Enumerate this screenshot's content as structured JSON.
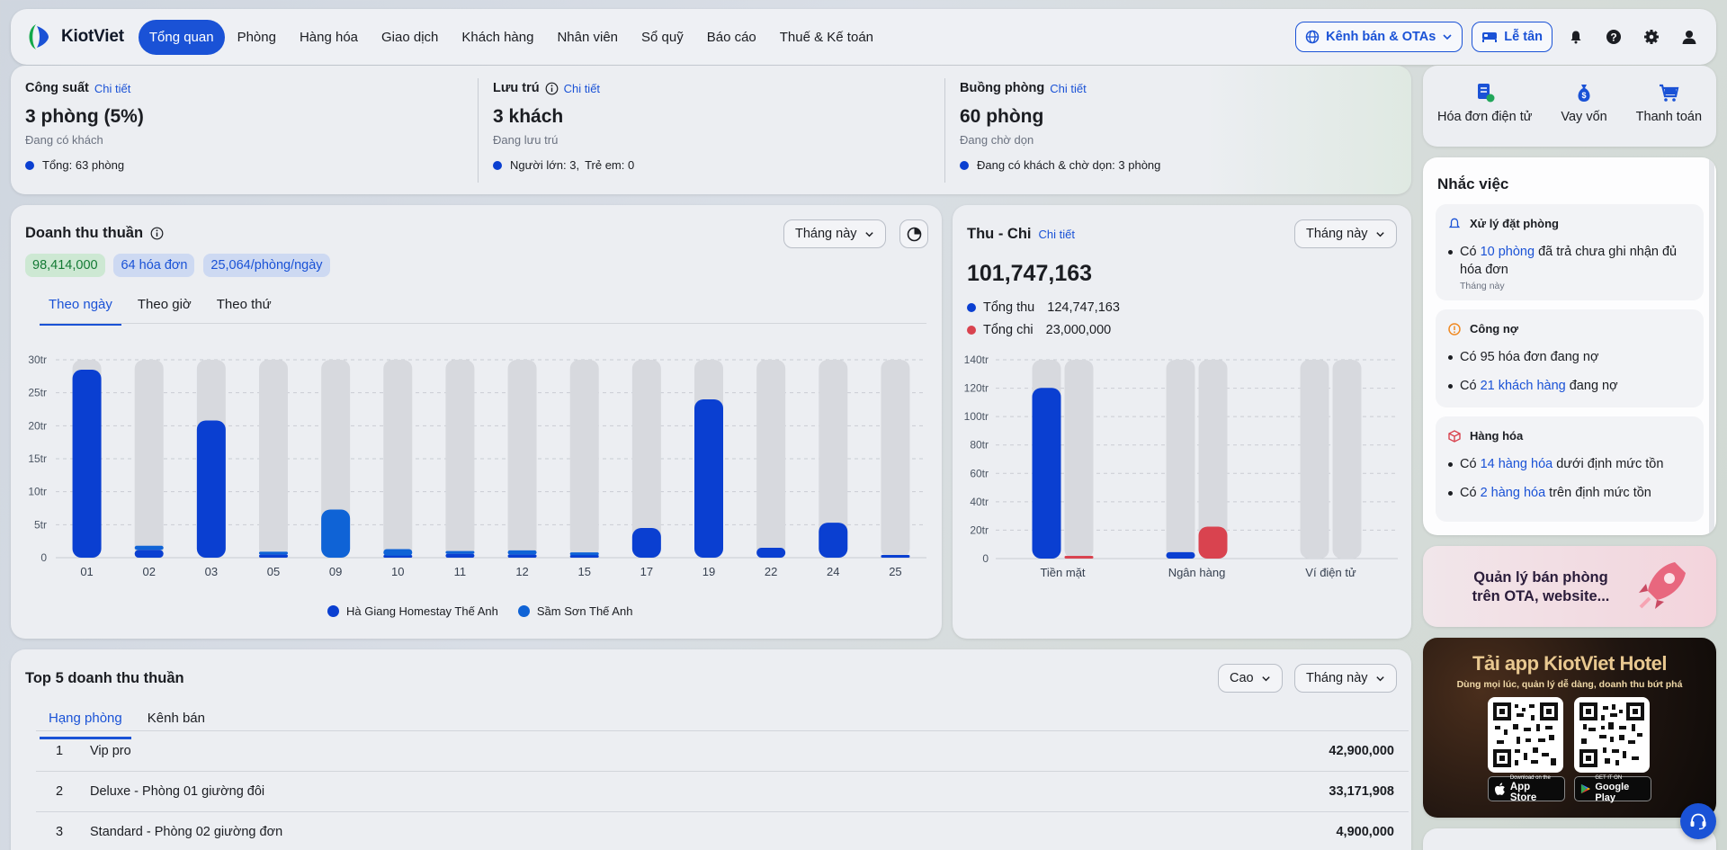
{
  "header": {
    "logo_text": "KiotViet",
    "nav": [
      "Tổng quan",
      "Phòng",
      "Hàng hóa",
      "Giao dịch",
      "Khách hàng",
      "Nhân viên",
      "Sổ quỹ",
      "Báo cáo",
      "Thuế & Kế toán"
    ],
    "channel_button": "Kênh bán & OTAs",
    "reception_button": "Lễ tân",
    "icons": [
      "bell-icon",
      "help-icon",
      "gear-icon",
      "user-icon"
    ]
  },
  "stats": {
    "capacity": {
      "title": "Công suất",
      "link": "Chi tiết",
      "value": "3 phòng (5%)",
      "sub": "Đang có khách",
      "foot": "Tổng: 63 phòng"
    },
    "stay": {
      "title": "Lưu trú",
      "link": "Chi tiết",
      "value": "3 khách",
      "sub": "Đang lưu trú",
      "foot_adults": "Người lớn: 3,",
      "foot_children": "Trẻ em: 0"
    },
    "housekeeping": {
      "title": "Buồng phòng",
      "link": "Chi tiết",
      "value": "60 phòng",
      "sub": "Đang chờ dọn",
      "foot": "Đang có khách & chờ dọn: 3 phòng"
    }
  },
  "revenue": {
    "title": "Doanh thu thuần",
    "period": "Tháng này",
    "chips": [
      "98,414,000",
      "64 hóa đơn",
      "25,064/phòng/ngày"
    ],
    "tabs": [
      "Theo ngày",
      "Theo giờ",
      "Theo thứ"
    ],
    "legend": [
      "Hà Giang Homestay Thế Anh",
      "Sầm Sơn Thế Anh"
    ]
  },
  "cashflow": {
    "title": "Thu - Chi",
    "link": "Chi tiết",
    "period": "Tháng này",
    "total": "101,747,163",
    "income_label": "Tổng thu",
    "income_value": "124,747,163",
    "expense_label": "Tổng chi",
    "expense_value": "23,000,000"
  },
  "chart_data": [
    {
      "type": "bar",
      "title": "Doanh thu thuần",
      "categories": [
        "01",
        "02",
        "03",
        "05",
        "09",
        "10",
        "11",
        "12",
        "15",
        "17",
        "19",
        "22",
        "24",
        "25"
      ],
      "y_ticks": [
        "0",
        "5tr",
        "10tr",
        "15tr",
        "20tr",
        "25tr",
        "30tr"
      ],
      "ylim": [
        0,
        30
      ],
      "series": [
        {
          "name": "Hà Giang Homestay Thế Anh",
          "color": "#0a3fd1",
          "values": [
            28.5,
            1.2,
            20.8,
            0.5,
            0,
            0.3,
            0.6,
            0.5,
            0.4,
            4.5,
            24,
            1.5,
            5.3,
            0.2
          ]
        },
        {
          "name": "Sầm Sơn Thế Anh",
          "color": "#0f63d6",
          "values": [
            0,
            0.6,
            0,
            0.3,
            7.3,
            1.0,
            0.2,
            0.6,
            0.2,
            0,
            0,
            0,
            0,
            0
          ]
        }
      ],
      "grid": true,
      "legend": "bottom"
    },
    {
      "type": "bar",
      "title": "Thu - Chi",
      "categories": [
        "Tiền mặt",
        "Ngân hàng",
        "Ví điện tử"
      ],
      "y_ticks": [
        "0",
        "20tr",
        "40tr",
        "60tr",
        "80tr",
        "100tr",
        "120tr",
        "140tr"
      ],
      "ylim": [
        0,
        140
      ],
      "series": [
        {
          "name": "Tổng thu",
          "color": "#0a3fd1",
          "values": [
            120.2,
            4.5,
            0
          ]
        },
        {
          "name": "Tổng chi",
          "color": "#d9434f",
          "values": [
            0.5,
            22.5,
            0
          ]
        }
      ],
      "grid": true,
      "legend": "top-left"
    }
  ],
  "right_panel": {
    "quick": [
      "Hóa đơn điện tử",
      "Vay vốn",
      "Thanh toán"
    ],
    "reminder_title": "Nhắc việc",
    "booking": {
      "title": "Xử lý đặt phòng",
      "line_pre": "Có ",
      "line_link": "10 phòng",
      "line_post": " đã trả chưa ghi nhận đủ hóa đơn",
      "note": "Tháng này"
    },
    "debt": {
      "title": "Công nợ",
      "line1": "Có 95 hóa đơn đang nợ",
      "line2_pre": "Có ",
      "line2_link": "21 khách hàng",
      "line2_post": " đang nợ"
    },
    "goods": {
      "title": "Hàng hóa",
      "line1_pre": "Có ",
      "line1_link": "14 hàng hóa",
      "line1_post": " dưới định mức tồn",
      "line2_pre": "Có ",
      "line2_link": "2 hàng hóa",
      "line2_post": " trên định mức tồn"
    },
    "ota_banner": "Quản lý bán phòng trên OTA, website...",
    "app_banner_title": "Tải app KiotViet Hotel",
    "app_banner_sub": "Dùng mọi lúc, quản lý dễ dàng, doanh thu bứt phá",
    "appstore_small": "Download on the",
    "appstore": "App Store",
    "googleplay_small": "GET IT ON",
    "googleplay": "Google Play"
  },
  "top5": {
    "title": "Top 5 doanh thu thuần",
    "sort": "Cao",
    "period": "Tháng này",
    "tabs": [
      "Hạng phòng",
      "Kênh bán"
    ],
    "rows": [
      {
        "idx": "1",
        "name": "Vip pro",
        "value": "42,900,000"
      },
      {
        "idx": "2",
        "name": "Deluxe - Phòng 01 giường đôi",
        "value": "33,171,908"
      },
      {
        "idx": "3",
        "name": "Standard - Phòng 02 giường đơn",
        "value": "4,900,000"
      }
    ]
  }
}
